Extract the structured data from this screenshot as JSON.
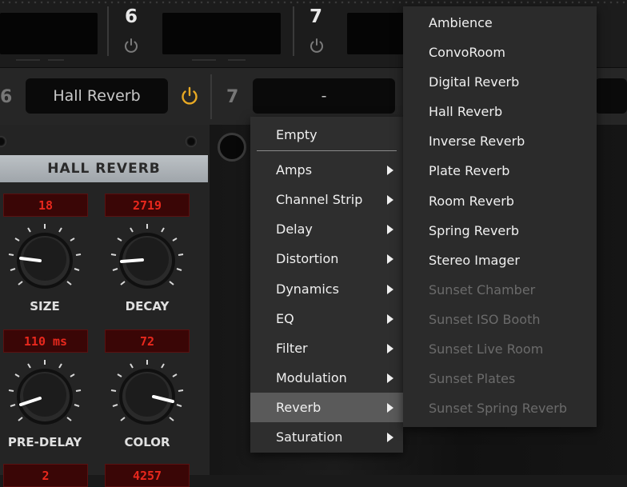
{
  "top_slots": [
    {
      "number": "6"
    },
    {
      "number": "7"
    }
  ],
  "slot_bar": {
    "left_number": "6",
    "left_preset": "Hall Reverb",
    "right_number": "7",
    "right_preset": "-"
  },
  "plugin": {
    "title": "HALL REVERB",
    "readouts": [
      "18",
      "2719",
      "110 ms",
      "72",
      "2",
      "4257"
    ],
    "knobs": [
      {
        "label": "SIZE"
      },
      {
        "label": "DECAY"
      },
      {
        "label": "PRE-DELAY"
      },
      {
        "label": "COLOR"
      }
    ]
  },
  "menu": {
    "empty_label": "Empty",
    "items": [
      {
        "label": "Amps"
      },
      {
        "label": "Channel Strip"
      },
      {
        "label": "Delay"
      },
      {
        "label": "Distortion"
      },
      {
        "label": "Dynamics"
      },
      {
        "label": "EQ"
      },
      {
        "label": "Filter"
      },
      {
        "label": "Modulation"
      },
      {
        "label": "Reverb"
      },
      {
        "label": "Saturation"
      }
    ],
    "selected": "Reverb"
  },
  "submenu": {
    "items": [
      {
        "label": "Ambience"
      },
      {
        "label": "ConvoRoom"
      },
      {
        "label": "Digital Reverb"
      },
      {
        "label": "Hall Reverb"
      },
      {
        "label": "Inverse Reverb"
      },
      {
        "label": "Plate Reverb"
      },
      {
        "label": "Room Reverb"
      },
      {
        "label": "Spring Reverb"
      },
      {
        "label": "Stereo Imager"
      },
      {
        "label": "Sunset Chamber"
      },
      {
        "label": "Sunset ISO Booth"
      },
      {
        "label": "Sunset Live Room"
      },
      {
        "label": "Sunset Plates"
      },
      {
        "label": "Sunset Spring Reverb"
      }
    ],
    "disabled_from_index": 9
  },
  "colors": {
    "power_active": "#e8a923",
    "power_inactive": "#7a7a7a",
    "readout_text": "#e8281d"
  }
}
